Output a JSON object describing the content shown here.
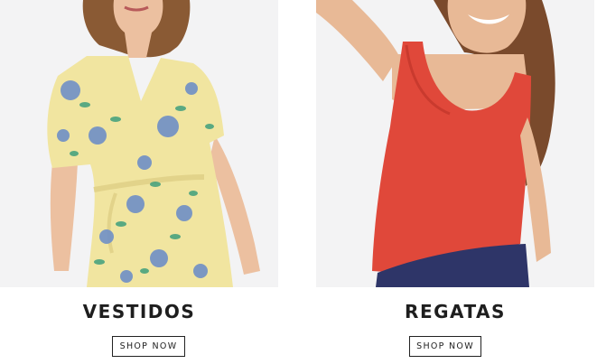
{
  "categories": [
    {
      "title": "VESTIDOS",
      "button_label": "SHOP NOW",
      "image_alt": "Floral yellow wrap dress"
    },
    {
      "title": "REGATAS",
      "button_label": "SHOP NOW",
      "image_alt": "Red tank top"
    }
  ],
  "colors": {
    "dress_yellow": "#f1e5a0",
    "flower_blue": "#6f8fc6",
    "leaf_green": "#3f9f7c",
    "tank_red": "#e0483a",
    "pants_navy": "#2e3568",
    "skin": "#e8b996",
    "hair_brown": "#7a4a2c",
    "background": "#f3f3f4"
  }
}
